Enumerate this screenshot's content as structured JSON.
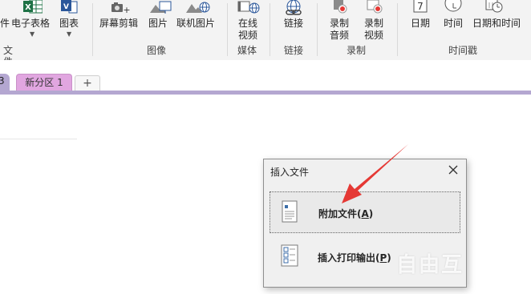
{
  "ribbon": {
    "buttons": {
      "file_partial": "件",
      "spreadsheet": "电子表格",
      "chart": "图表",
      "screen_clip": "屏幕剪辑",
      "picture": "图片",
      "online_picture": "联机图片",
      "online_video_line1": "在线",
      "online_video_line2": "视频",
      "link": "链接",
      "record_audio_line1": "录制",
      "record_audio_line2": "音频",
      "record_video_line1": "录制",
      "record_video_line2": "视频",
      "date": "日期",
      "time": "时间",
      "date_time": "日期和时间",
      "date_icon_num": "7"
    },
    "groups": {
      "file_partial": "文件",
      "images": "图像",
      "media": "媒体",
      "links": "链接",
      "recording": "录制",
      "timestamp": "时间戳"
    }
  },
  "tabs": {
    "section_first_partial": "3",
    "section_new": "新分区 1",
    "add_tab": "+"
  },
  "dialog": {
    "title": "插入文件",
    "close": "✕",
    "option1_label": "附加文件(",
    "option1_key": "A",
    "option1_suffix": ")",
    "option2_label": "插入打印输出(",
    "option2_key": "P",
    "option2_suffix": ")"
  },
  "watermark": "自由互",
  "colors": {
    "section_bar": "#b4a7d1",
    "section_tab": "#e1a6e0",
    "arrow": "#e53935",
    "excel_green": "#1e7145",
    "chart_blue": "#2b579a"
  }
}
